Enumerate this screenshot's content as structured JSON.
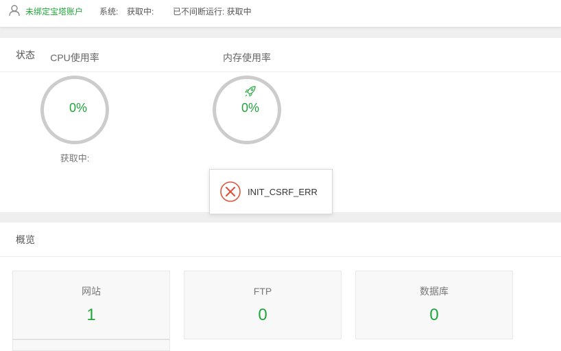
{
  "topbar": {
    "account_text": "未绑定宝塔账户",
    "system_label": "系统:",
    "system_value": "获取中:",
    "uptime_text": "已不间断运行: 获取中"
  },
  "status": {
    "title": "状态",
    "cpu": {
      "title": "CPU使用率",
      "value": "0%",
      "sub": "获取中:"
    },
    "memory": {
      "title": "内存使用率",
      "value": "0%",
      "icon": "rocket-icon"
    }
  },
  "toast": {
    "message": "INIT_CSRF_ERR",
    "icon": "error-circle-icon"
  },
  "overview": {
    "title": "概览",
    "cards": [
      {
        "label": "网站",
        "value": "1"
      },
      {
        "label": "FTP",
        "value": "0"
      },
      {
        "label": "数据库",
        "value": "0"
      }
    ]
  },
  "colors": {
    "accent": "#20a53a",
    "error": "#e0533a",
    "ring": "#cccccc"
  }
}
